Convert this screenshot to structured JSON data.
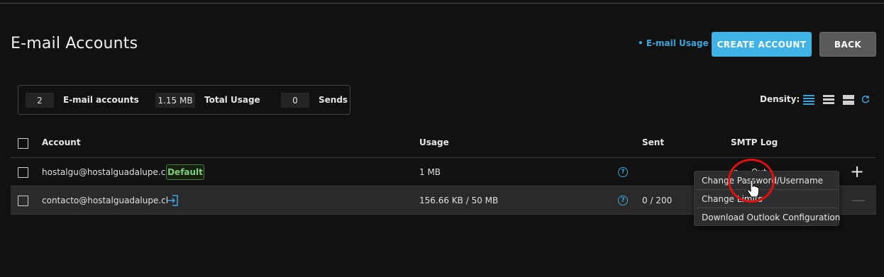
{
  "header": {
    "title": "E-mail Accounts",
    "usage_link": "• E-mail Usage",
    "create_button": "CREATE ACCOUNT",
    "back_button": "BACK"
  },
  "stats": {
    "accounts_value": "2",
    "accounts_label": "E-mail accounts",
    "usage_value": "1.15 MB",
    "usage_label": "Total Usage",
    "sends_value": "0",
    "sends_label": "Sends"
  },
  "density": {
    "label": "Density:",
    "options": [
      "compact",
      "normal",
      "spacious"
    ],
    "selected": "compact",
    "accent_color": "#3aa6de"
  },
  "table": {
    "columns": [
      "Account",
      "Usage",
      "Sent",
      "SMTP Log"
    ],
    "rows": [
      {
        "account": "hostalgu@hostalguadalupe.cl",
        "badge": "Default",
        "usage": "1 MB",
        "sent": "",
        "smtp_log": "In → Out"
      },
      {
        "account": "contacto@hostalguadalupe.cl",
        "badge": "",
        "usage": "156.66 KB / 50 MB",
        "sent": "0 / 200",
        "smtp_log": ""
      }
    ]
  },
  "context_menu": {
    "items": [
      "Change Password/Username",
      "Change Limits",
      "Download Outlook Configuration"
    ]
  },
  "icons": {
    "help": "question-circle-icon",
    "login": "login-arrow-icon",
    "plus": "plus-icon",
    "minus": "minus-icon",
    "refresh": "refresh-icon",
    "cursor": "hand-pointer-icon"
  }
}
